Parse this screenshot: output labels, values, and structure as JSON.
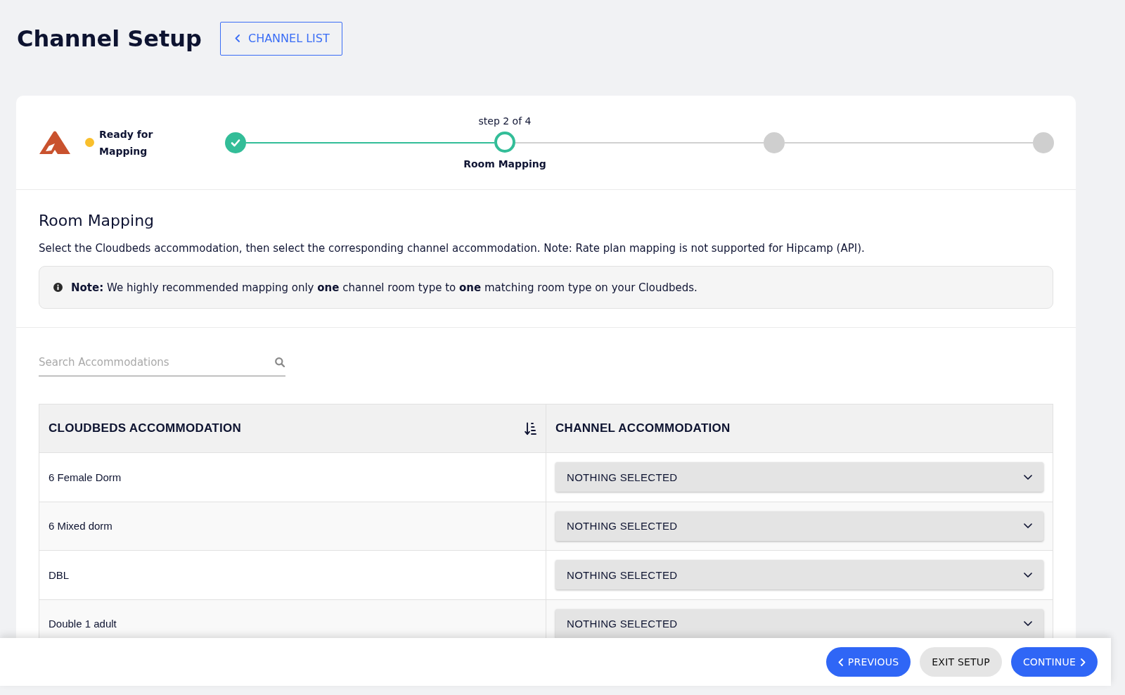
{
  "header": {
    "title": "Channel Setup",
    "back_button": {
      "label": "CHANNEL LIST"
    }
  },
  "channel": {
    "status": "Ready for Mapping"
  },
  "stepper": {
    "steps": [
      {
        "kind": "done"
      },
      {
        "kind": "current",
        "caption": "step 2 of 4",
        "label": "Room Mapping"
      },
      {
        "kind": "pending"
      },
      {
        "kind": "pending"
      }
    ]
  },
  "section": {
    "title": "Room Mapping",
    "description": "Select the Cloudbeds accommodation, then select the corresponding channel accommodation. Note: Rate plan mapping is not supported for Hipcamp (API).",
    "note": "**Note:** We highly recommended mapping only **one** channel room type to **one** matching room type on your Cloudbeds."
  },
  "search": {
    "placeholder": "Search Accommodations"
  },
  "table": {
    "columns": [
      {
        "label": "CLOUDBEDS ACCOMMODATION",
        "sortable": true
      },
      {
        "label": "CHANNEL ACCOMMODATION",
        "sortable": false
      }
    ],
    "rows": [
      {
        "cloudbeds_accommodation": "6 Female Dorm",
        "channel_accommodation": "NOTHING SELECTED"
      },
      {
        "cloudbeds_accommodation": "6 Mixed dorm",
        "channel_accommodation": "NOTHING SELECTED"
      },
      {
        "cloudbeds_accommodation": "DBL",
        "channel_accommodation": "NOTHING SELECTED"
      },
      {
        "cloudbeds_accommodation": "Double 1 adult",
        "channel_accommodation": "NOTHING SELECTED"
      }
    ]
  },
  "footer": {
    "buttons": [
      {
        "label": "PREVIOUS",
        "kind": "back"
      },
      {
        "label": "EXIT SETUP",
        "kind": "secondary"
      },
      {
        "label": "CONTINUE",
        "kind": "next"
      }
    ]
  }
}
